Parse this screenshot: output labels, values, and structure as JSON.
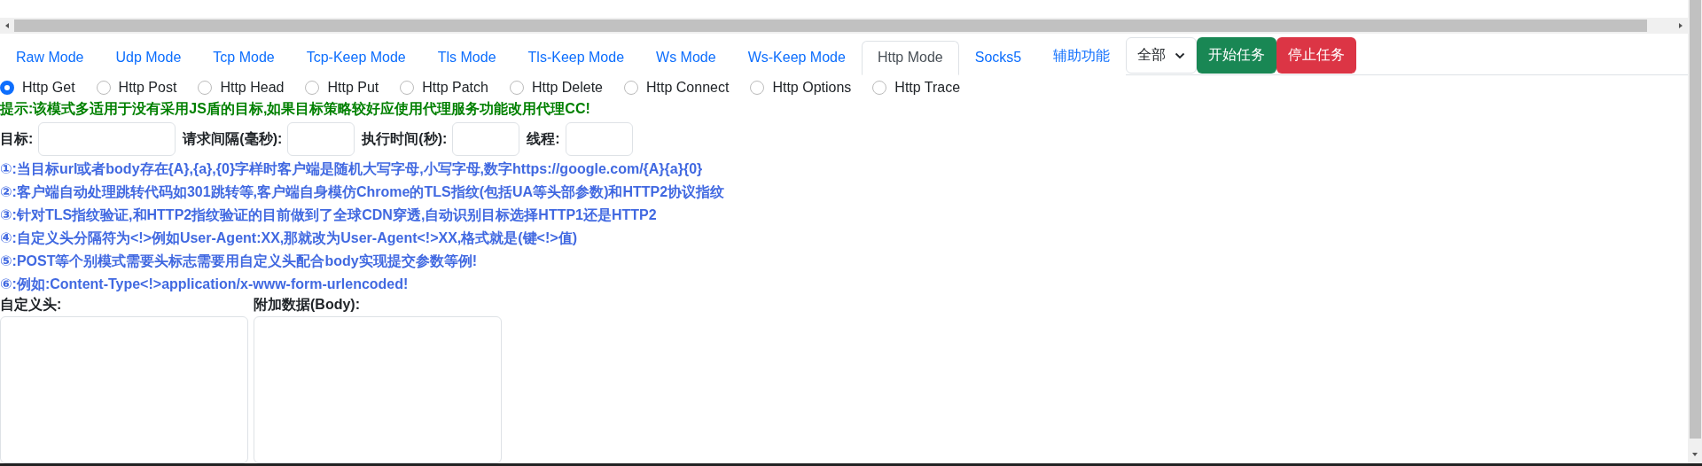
{
  "tabs": [
    {
      "label": "Raw Mode",
      "selected": false
    },
    {
      "label": "Udp Mode",
      "selected": false
    },
    {
      "label": "Tcp Mode",
      "selected": false
    },
    {
      "label": "Tcp-Keep Mode",
      "selected": false
    },
    {
      "label": "Tls Mode",
      "selected": false
    },
    {
      "label": "Tls-Keep Mode",
      "selected": false
    },
    {
      "label": "Ws Mode",
      "selected": false
    },
    {
      "label": "Ws-Keep Mode",
      "selected": false
    },
    {
      "label": "Http Mode",
      "selected": true
    },
    {
      "label": "Socks5",
      "selected": false
    },
    {
      "label": "辅助功能",
      "selected": false
    }
  ],
  "scope_select": {
    "value": "全部"
  },
  "buttons": [
    {
      "label": "开始任务",
      "kind": "start"
    },
    {
      "label": "停止任务",
      "kind": "stop"
    }
  ],
  "methods": [
    {
      "label": "Http Get",
      "selected": true
    },
    {
      "label": "Http Post",
      "selected": false
    },
    {
      "label": "Http Head",
      "selected": false
    },
    {
      "label": "Http Put",
      "selected": false
    },
    {
      "label": "Http Patch",
      "selected": false
    },
    {
      "label": "Http Delete",
      "selected": false
    },
    {
      "label": "Http Connect",
      "selected": false
    },
    {
      "label": "Http Options",
      "selected": false
    },
    {
      "label": "Http Trace",
      "selected": false
    }
  ],
  "hint": "提示:该模式多适用于没有采用JS盾的目标,如果目标策略较好应使用代理服务功能改用代理CC!",
  "fields": [
    {
      "label": "目标:",
      "kind": "wide"
    },
    {
      "label": "请求间隔(毫秒):",
      "kind": "short"
    },
    {
      "label": "执行时间(秒):",
      "kind": "short"
    },
    {
      "label": "线程:",
      "kind": "short"
    }
  ],
  "notes": [
    "①:当目标url或者body存在{A},{a},{0}字样时客户端是随机大写字母,小写字母,数字https://google.com/{A}{a}{0}",
    "②:客户端自动处理跳转代码如301跳转等,客户端自身模仿Chrome的TLS指纹(包括UA等头部参数)和HTTP2协议指纹",
    "③:针对TLS指纹验证,和HTTP2指纹验证的目前做到了全球CDN穿透,自动识别目标选择HTTP1还是HTTP2",
    "④:自定义头分隔符为<!>例如User-Agent:XX,那就改为User-Agent<!>XX,格式就是(键<!>值)",
    "⑤:POST等个别模式需要头标志需要用自定义头配合body实现提交参数等例!",
    "⑥:例如:Content-Type<!>application/x-www-form-urlencoded!"
  ],
  "editors": [
    {
      "label": "自定义头:"
    },
    {
      "label": "附加数据(Body):"
    }
  ]
}
